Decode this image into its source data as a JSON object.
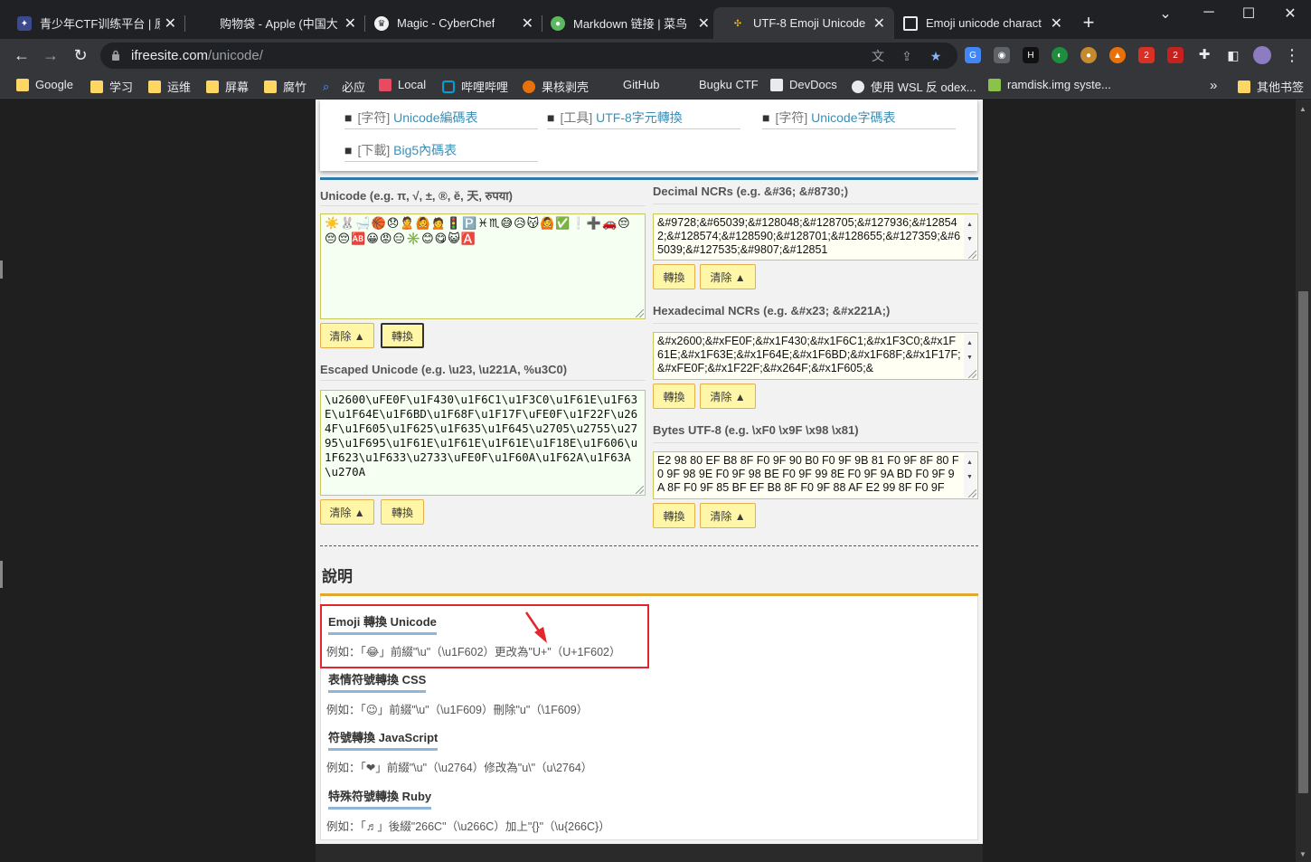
{
  "tabs": [
    {
      "title": "青少年CTF训练平台 | 原",
      "close": "✕"
    },
    {
      "title": "购物袋 - Apple (中国大",
      "close": "✕"
    },
    {
      "title": "Magic - CyberChef",
      "close": "✕"
    },
    {
      "title": "Markdown 链接 | 菜鸟",
      "close": "✕"
    },
    {
      "title": "UTF-8 Emoji Unicode",
      "close": "✕"
    },
    {
      "title": "Emoji unicode charact",
      "close": "✕"
    }
  ],
  "window_controls": {
    "minimize": "─",
    "maximize": "☐",
    "close": "✕",
    "tab_search": "⌄",
    "new_tab": "+"
  },
  "address": {
    "host": "ifreesite.com",
    "path": "/unicode/"
  },
  "nav": {
    "back": "←",
    "forward": "→",
    "reload": "↻",
    "menu": "⋮"
  },
  "extensions": [
    {
      "name": "translate-ext",
      "label": "G",
      "color": "#4285f4"
    },
    {
      "name": "mask-ext",
      "label": "◉",
      "color": "#5f6368"
    },
    {
      "name": "hacker-ext",
      "label": "H",
      "color": "#111111"
    },
    {
      "name": "green-ext",
      "label": "◐",
      "color": "#1e8e3e"
    },
    {
      "name": "cookie-ext",
      "label": "●",
      "color": "#c58a2e"
    },
    {
      "name": "fox-ext",
      "label": "▲",
      "color": "#e8710a"
    },
    {
      "name": "red-ext",
      "label": "2",
      "color": "#d93025"
    },
    {
      "name": "abp-ext",
      "label": "2",
      "color": "#c5221f"
    }
  ],
  "bookmarks": [
    {
      "label": "Google",
      "color": "#fdd663"
    },
    {
      "label": "学习",
      "color": "#fdd663"
    },
    {
      "label": "运维",
      "color": "#fdd663"
    },
    {
      "label": "屏幕",
      "color": "#fdd663"
    },
    {
      "label": "腐竹",
      "color": "#fdd663"
    },
    {
      "label": "必应",
      "color": "#1a73e8"
    },
    {
      "label": "Local",
      "color": "#e84a5f"
    },
    {
      "label": "哔哩哔哩",
      "color": "#00a1d6"
    },
    {
      "label": "果核剥壳",
      "color": "#e8710a"
    },
    {
      "label": "GitHub",
      "color": "#35363a"
    },
    {
      "label": "Bugku CTF",
      "color": "#35363a"
    },
    {
      "label": "DevDocs",
      "color": "#e8eaed"
    },
    {
      "label": "使用 WSL 反 odex...",
      "color": "#e8eaed"
    },
    {
      "label": "ramdisk.img syste...",
      "color": "#8bc34a"
    }
  ],
  "bookmarks_more": "»",
  "other_bookmarks": "其他书签",
  "nav_links": [
    {
      "tag": "[字符]",
      "text": "Unicode編碼表"
    },
    {
      "tag": "[工具]",
      "text": "UTF-8字元轉換"
    },
    {
      "tag": "[字符]",
      "text": "Unicode字碼表"
    },
    {
      "tag": "[下載]",
      "text": "Big5內碼表"
    }
  ],
  "unicode_field": {
    "label": "Unicode (e.g. π, √, ±, ®, ĕ, 天, रुपया)",
    "value": "☀️🐰🛁🏀😞🙎🙆🙍🚦🅿️♓♏😅😥😽🙆✅❕➕🚗😔😔😔🆎😀😡😑✳️😊😋😺🅰️"
  },
  "escaped_field": {
    "label": "Escaped Unicode (e.g. \\u23, \\u221A, %u3C0)",
    "value": "\\u2600\\uFE0F\\u1F430\\u1F6C1\\u1F3C0\\u1F61E\\u1F63E\\u1F64E\\u1F6BD\\u1F68F\\u1F17F\\uFE0F\\u1F22F\\u264F\\u1F605\\u1F625\\u1F635\\u1F645\\u2705\\u2755\\u2795\\u1F695\\u1F61E\\u1F61E\\u1F61E\\u1F18E\\u1F606\\u1F623\\u1F633\\u2733\\uFE0F\\u1F60A\\u1F62A\\u1F63A\\u270A"
  },
  "decimal_field": {
    "label": "Decimal NCRs (e.g. &#36; &#8730;)",
    "value": "&#9728;&#65039;&#128048;&#128705;&#127936;&#128542;&#128574;&#128590;&#128701;&#128655;&#127359;&#65039;&#127535;&#9807;&#12851"
  },
  "hex_field": {
    "label": "Hexadecimal NCRs (e.g. &#x23; &#x221A;)",
    "value": "&#x2600;&#xFE0F;&#x1F430;&#x1F6C1;&#x1F3C0;&#x1F61E;&#x1F63E;&#x1F64E;&#x1F6BD;&#x1F68F;&#x1F17F;&#xFE0F;&#x1F22F;&#x264F;&#x1F605;&"
  },
  "bytes_field": {
    "label": "Bytes UTF-8 (e.g. \\xF0 \\x9F \\x98 \\x81)",
    "value": "E2 98 80 EF B8 8F F0 9F 90 B0 F0 9F 9B 81 F0 9F 8F 80 F0 9F 98 9E F0 9F 98 BE F0 9F 99 8E F0 9F 9A BD F0 9F 9A 8F F0 9F 85 BF EF B8 8F F0 9F 88 AF E2 99 8F F0 9F"
  },
  "buttons": {
    "clear": "清除 ▲",
    "convert": "轉換"
  },
  "explain": {
    "heading": "說明",
    "sections": [
      {
        "title": "Emoji 轉換 Unicode",
        "text": "例如：「😂」前綴\"\\u\"（\\u1F602）更改為\"U+\"（U+1F602）"
      },
      {
        "title": "表情符號轉換 CSS",
        "text": "例如：「😉」前綴\"\\u\"（\\u1F609）刪除\"u\"（\\1F609）"
      },
      {
        "title": "符號轉換 JavaScript",
        "text": "例如：「❤」前綴\"\\u\"（\\u2764）修改為\"u\\\"（u\\2764）"
      },
      {
        "title": "特殊符號轉換 Ruby",
        "text": "例如：「♬」後綴\"266C\"（\\u266C）加上\"{}\"（\\u{266C}）"
      }
    ]
  }
}
